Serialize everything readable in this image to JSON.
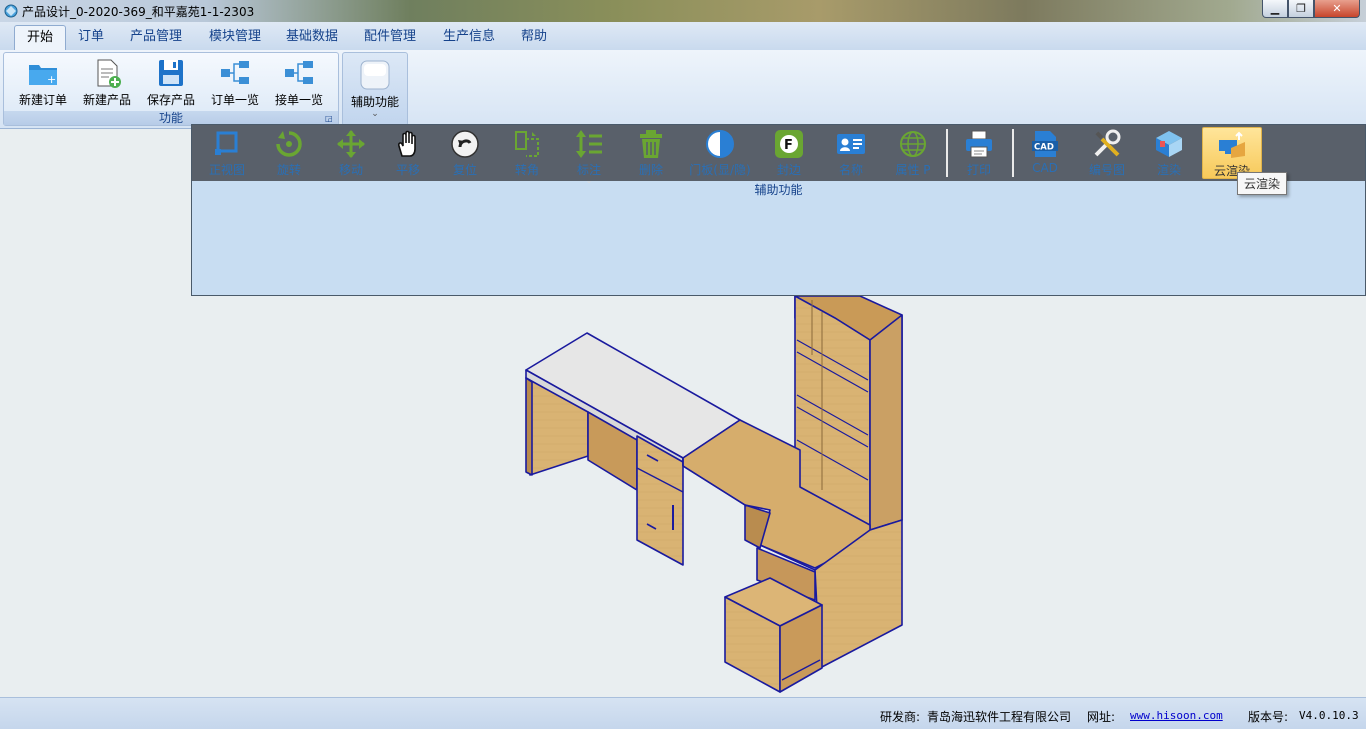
{
  "window": {
    "title": "产品设计_0-2020-369_和平嘉苑1-1-2303",
    "minimize": "▁",
    "maximize": "❐",
    "close": "✕"
  },
  "menu": {
    "tabs": [
      {
        "label": "开始"
      },
      {
        "label": "订单"
      },
      {
        "label": "产品管理"
      },
      {
        "label": "模块管理"
      },
      {
        "label": "基础数据"
      },
      {
        "label": "配件管理"
      },
      {
        "label": "生产信息"
      },
      {
        "label": "帮助"
      }
    ]
  },
  "ribbon": {
    "group_function": {
      "label": "功能",
      "buttons": [
        {
          "label": "新建订单",
          "icon": "folder-plus-icon"
        },
        {
          "label": "新建产品",
          "icon": "document-plus-icon"
        },
        {
          "label": "保存产品",
          "icon": "save-icon"
        },
        {
          "label": "订单一览",
          "icon": "tree-icon"
        },
        {
          "label": "接单一览",
          "icon": "tree-icon"
        }
      ]
    },
    "group_aux": {
      "button": {
        "label": "辅助功能",
        "arrow": "⌄"
      }
    }
  },
  "aux_toolbar": {
    "label": "辅助功能",
    "tools": [
      {
        "label": "正视图",
        "icon": "front-view-icon"
      },
      {
        "label": "旋转",
        "icon": "rotate-icon"
      },
      {
        "label": "移动",
        "icon": "move-icon"
      },
      {
        "label": "平移",
        "icon": "hand-icon"
      },
      {
        "label": "复位",
        "icon": "reset-icon"
      },
      {
        "label": "转角",
        "icon": "corner-icon"
      },
      {
        "label": "标注",
        "icon": "dimension-icon"
      },
      {
        "label": "删除",
        "icon": "trash-icon"
      },
      {
        "label": "门板(显/隐)",
        "icon": "half-circle-icon"
      },
      {
        "label": "封边",
        "icon": "edge-banding-icon"
      },
      {
        "label": "名称",
        "icon": "name-card-icon"
      },
      {
        "label": "属性 P",
        "icon": "globe-icon"
      },
      {
        "label": "打印",
        "icon": "printer-icon"
      },
      {
        "label": "CAD",
        "icon": "cad-icon"
      },
      {
        "label": "编号图",
        "icon": "tools-icon"
      },
      {
        "label": "渲染",
        "icon": "render-icon"
      },
      {
        "label": "云渲染",
        "icon": "cloud-render-icon"
      }
    ],
    "tooltip": "云渲染",
    "dimension_arrow": "⌄"
  },
  "status": {
    "developer_label": "研发商:",
    "developer": "青岛海迅软件工程有限公司",
    "website_label": "网址:",
    "website": "www.hisoon.com",
    "version_label": "版本号:",
    "version": "V4.0.10.3"
  },
  "colors": {
    "wood": "#d9b373",
    "edge": "#1a1a9e",
    "toolbar_bg": "#59606a",
    "tool_label": "#2a6fb5",
    "ribbon_text": "#15428b"
  }
}
